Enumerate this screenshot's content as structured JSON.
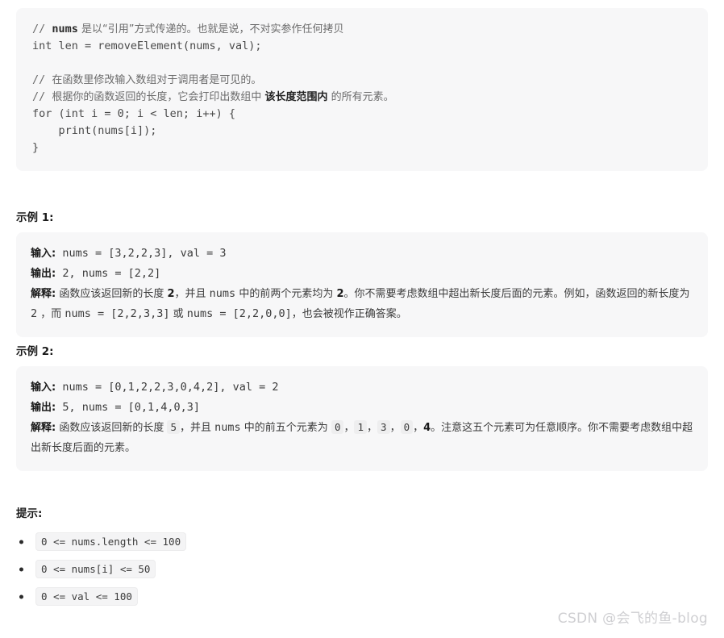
{
  "code_block": {
    "language": "c-like-pseudocode",
    "lines": [
      {
        "type": "comment_mixed",
        "prefix": "// ",
        "code_bold": "nums",
        "text": " 是以“引用”方式传递的。也就是说，不对实参作任何拷贝"
      },
      {
        "type": "code",
        "text": "int len = removeElement(nums, val);"
      },
      {
        "type": "blank",
        "text": ""
      },
      {
        "type": "comment",
        "prefix": "// ",
        "text": "在函数里修改输入数组对于调用者是可见的。"
      },
      {
        "type": "comment_bold_span",
        "prefix": "// ",
        "text_before": "根据你的函数返回的长度，它会打印出数组中 ",
        "bold": "该长度范围内",
        "text_after": " 的所有元素。"
      },
      {
        "type": "code",
        "text": "for (int i = 0; i < len; i++) {"
      },
      {
        "type": "code",
        "text": "    print(nums[i]);"
      },
      {
        "type": "code",
        "text": "}"
      }
    ]
  },
  "examples": [
    {
      "heading": "示例 1:",
      "input_label": "输入:",
      "input_value": "nums = [3,2,2,3], val = 3",
      "output_label": "输出:",
      "output_value": "2, nums = [2,2]",
      "explain_label": "解释:",
      "explain_parts": [
        {
          "kind": "text",
          "value": "函数应该返回新的长度 "
        },
        {
          "kind": "bold",
          "value": "2"
        },
        {
          "kind": "text",
          "value": "，并且 "
        },
        {
          "kind": "mono",
          "value": "nums"
        },
        {
          "kind": "text",
          "value": " 中的前两个元素均为 "
        },
        {
          "kind": "bold",
          "value": "2"
        },
        {
          "kind": "text",
          "value": "。你不需要考虑数组中超出新长度后面的元素。例如，函数返回的新长度为 "
        },
        {
          "kind": "mono",
          "value": "2"
        },
        {
          "kind": "text",
          "value": " ，而 "
        },
        {
          "kind": "mono",
          "value": "nums = [2,2,3,3]"
        },
        {
          "kind": "text",
          "value": " 或 "
        },
        {
          "kind": "mono",
          "value": "nums = [2,2,0,0]"
        },
        {
          "kind": "text",
          "value": "，也会被视作正确答案。"
        }
      ]
    },
    {
      "heading": "示例 2:",
      "input_label": "输入:",
      "input_value": "nums = [0,1,2,2,3,0,4,2], val = 2",
      "output_label": "输出:",
      "output_value": "5, nums = [0,1,4,0,3]",
      "explain_label": "解释:",
      "explain_parts": [
        {
          "kind": "text",
          "value": "函数应该返回新的长度 "
        },
        {
          "kind": "code",
          "value": "5"
        },
        {
          "kind": "text",
          "value": "，并且 "
        },
        {
          "kind": "mono",
          "value": "nums"
        },
        {
          "kind": "text",
          "value": " 中的前五个元素为 "
        },
        {
          "kind": "code",
          "value": "0"
        },
        {
          "kind": "text",
          "value": "，"
        },
        {
          "kind": "code",
          "value": "1"
        },
        {
          "kind": "text",
          "value": "，"
        },
        {
          "kind": "code",
          "value": "3"
        },
        {
          "kind": "text",
          "value": "，"
        },
        {
          "kind": "code",
          "value": "0"
        },
        {
          "kind": "text",
          "value": "，"
        },
        {
          "kind": "bold",
          "value": "4"
        },
        {
          "kind": "text",
          "value": "。注意这五个元素可为任意顺序。你不需要考虑数组中超出新长度后面的元素。"
        }
      ]
    }
  ],
  "hints": {
    "heading": "提示:",
    "items": [
      "0 <= nums.length <= 100",
      "0 <= nums[i] <= 50",
      "0 <= val <= 100"
    ]
  },
  "watermark": {
    "text": "CSDN @会飞的鱼-blog"
  },
  "colors": {
    "page_background": "#ffffff",
    "code_background": "#f7f7f8",
    "inline_code_background": "#eeeeef",
    "body_text": "#3b3b3b",
    "heading_text": "#1a1a1a",
    "comment_text": "#6b6b6b",
    "watermark_text": "#cfcfd2"
  }
}
